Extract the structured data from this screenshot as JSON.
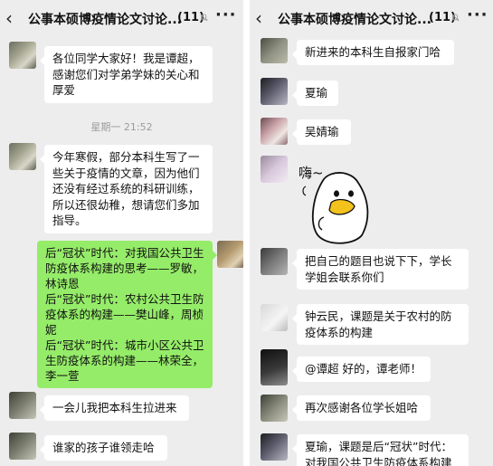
{
  "left_panel": {
    "back_glyph": "‹",
    "title": "公事本硕博疫情论文讨论...",
    "count": "(11)",
    "more_glyph": "···",
    "time_divider": "星期一 21:52",
    "messages": [
      {
        "text": "各位同学大家好！我是谭超，感谢您们对学弟学妹的关心和厚爱"
      },
      {
        "text": "今年寒假，部分本科生写了一些关于疫情的文章，因为他们还没有经过系统的科研训练，所以还很幼稚，想请您们多加指导。"
      },
      {
        "lines": [
          "后“冠状”时代：对我国公共卫生防疫体系构建的思考——罗敏，林诗恩",
          "后“冠状”时代：农村公共卫生防疫体系的构建——樊山峰，周桢妮",
          "后“冠状”时代：城市小区公共卫生防疫体系的构建——林荣全，李一萱"
        ]
      },
      {
        "text": "一会儿我把本科生拉进来"
      },
      {
        "text": "谁家的孩子谁领走哈"
      }
    ]
  },
  "right_panel": {
    "back_glyph": "‹",
    "title": "公事本硕博疫情论文讨论...",
    "count": "(11)",
    "more_glyph": "···",
    "messages": [
      {
        "text": "新进来的本科生自报家门哈"
      },
      {
        "text": "夏瑜"
      },
      {
        "text": "吴婧瑜"
      },
      {
        "sticker_text": "嗨~"
      },
      {
        "text": "把自己的题目也说下下，学长学姐会联系你们"
      },
      {
        "text": "钟云民，课题是关于农村的防疫体系的构建"
      },
      {
        "text": "@谭超 好的，谭老师！"
      },
      {
        "text": "再次感谢各位学长姐哈"
      },
      {
        "lines": [
          "夏瑜，课题是后“冠状”时代：",
          "对我国公共卫生防疫体系构建"
        ]
      }
    ]
  },
  "colors": {
    "chat_background": "#ededed",
    "incoming_bubble": "#ffffff",
    "outgoing_bubble": "#95ec69",
    "time_text": "#9c9c9c"
  },
  "icons": [
    "back-arrow-icon",
    "mute-bell-icon",
    "more-icon"
  ]
}
